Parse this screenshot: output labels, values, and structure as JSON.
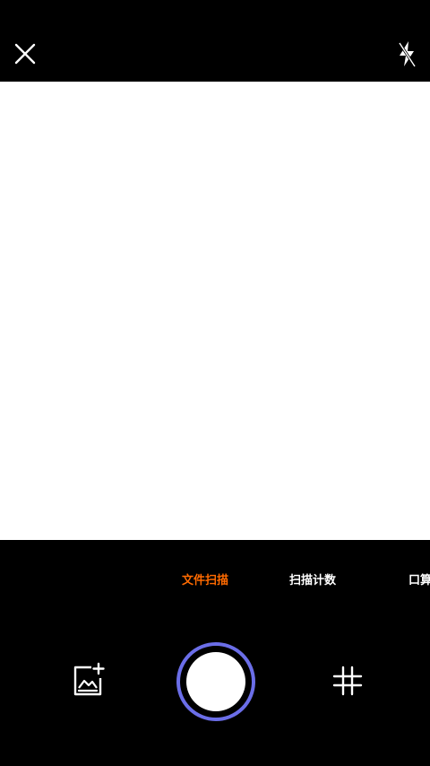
{
  "top_bar": {
    "close_icon": "close-icon",
    "flash_icon": "flash-off-icon"
  },
  "mode_tabs": [
    {
      "label": "文件扫描",
      "active": true
    },
    {
      "label": "扫描计数",
      "active": false
    },
    {
      "label": "口算",
      "active": false
    }
  ],
  "bottom_controls": {
    "gallery_icon": "gallery-add-icon",
    "shutter": "shutter-button",
    "grid_icon": "grid-icon"
  },
  "colors": {
    "background": "#000000",
    "viewfinder": "#ffffff",
    "active_tab": "#ff6a00",
    "shutter_ring": "#6b6ee8"
  }
}
